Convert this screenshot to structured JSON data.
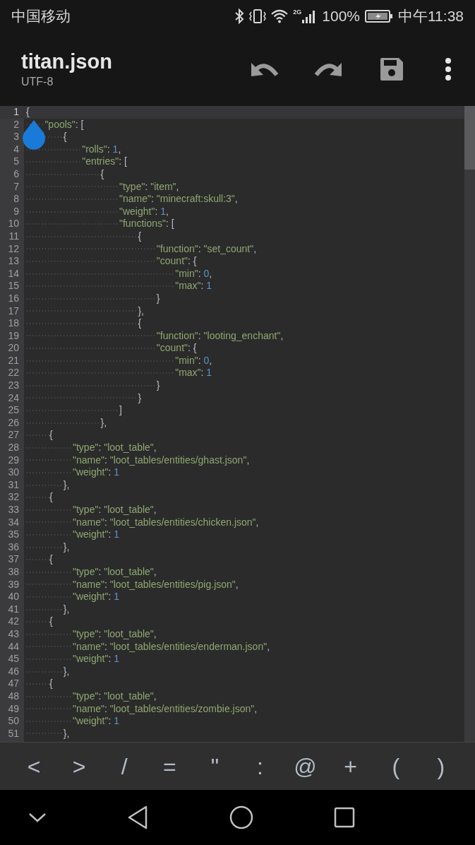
{
  "status_bar": {
    "carrier": "中国移动",
    "network": "2G",
    "battery": "100%",
    "time": "中午11:38"
  },
  "toolbar": {
    "title": "titan.json",
    "encoding": "UTF-8"
  },
  "editor": {
    "lines": [
      {
        "number": "1",
        "text": "{",
        "selected": true
      },
      {
        "number": "2",
        "text": "    \"pools\": [",
        "selected": false
      },
      {
        "number": "3",
        "text": "        {",
        "selected": false
      },
      {
        "number": "4",
        "text": "            \"rolls\": 1,",
        "selected": false
      },
      {
        "number": "5",
        "text": "            \"entries\": [",
        "selected": false
      },
      {
        "number": "6",
        "text": "                {",
        "selected": false
      },
      {
        "number": "7",
        "text": "                    \"type\": \"item\",",
        "selected": false
      },
      {
        "number": "8",
        "text": "                    \"name\": \"minecraft:skull:3\",",
        "selected": false
      },
      {
        "number": "9",
        "text": "                    \"weight\": 1,",
        "selected": false
      },
      {
        "number": "10",
        "text": "                    \"functions\": [",
        "selected": false
      },
      {
        "number": "11",
        "text": "                        {",
        "selected": false
      },
      {
        "number": "12",
        "text": "                            \"function\": \"set_count\",",
        "selected": false
      },
      {
        "number": "13",
        "text": "                            \"count\": {",
        "selected": false
      },
      {
        "number": "14",
        "text": "                                \"min\": 0,",
        "selected": false
      },
      {
        "number": "15",
        "text": "                                \"max\": 1",
        "selected": false
      },
      {
        "number": "16",
        "text": "                            }",
        "selected": false
      },
      {
        "number": "17",
        "text": "                        },",
        "selected": false
      },
      {
        "number": "18",
        "text": "                        {",
        "selected": false
      },
      {
        "number": "19",
        "text": "                            \"function\": \"looting_enchant\",",
        "selected": false
      },
      {
        "number": "20",
        "text": "                            \"count\": {",
        "selected": false
      },
      {
        "number": "21",
        "text": "                                \"min\": 0,",
        "selected": false
      },
      {
        "number": "22",
        "text": "                                \"max\": 1",
        "selected": false
      },
      {
        "number": "23",
        "text": "                            }",
        "selected": false
      },
      {
        "number": "24",
        "text": "                        }",
        "selected": false
      },
      {
        "number": "25",
        "text": "                    ]",
        "selected": false
      },
      {
        "number": "26",
        "text": "                },",
        "selected": false
      },
      {
        "number": "27",
        "text": "     {",
        "selected": false
      },
      {
        "number": "28",
        "text": "          \"type\": \"loot_table\",",
        "selected": false
      },
      {
        "number": "29",
        "text": "          \"name\": \"loot_tables/entities/ghast.json\",",
        "selected": false
      },
      {
        "number": "30",
        "text": "          \"weight\": 1",
        "selected": false
      },
      {
        "number": "31",
        "text": "        },",
        "selected": false
      },
      {
        "number": "32",
        "text": "     {",
        "selected": false
      },
      {
        "number": "33",
        "text": "          \"type\": \"loot_table\",",
        "selected": false
      },
      {
        "number": "34",
        "text": "          \"name\": \"loot_tables/entities/chicken.json\",",
        "selected": false
      },
      {
        "number": "35",
        "text": "          \"weight\": 1",
        "selected": false
      },
      {
        "number": "36",
        "text": "        },",
        "selected": false
      },
      {
        "number": "37",
        "text": "     {",
        "selected": false
      },
      {
        "number": "38",
        "text": "          \"type\": \"loot_table\",",
        "selected": false
      },
      {
        "number": "39",
        "text": "          \"name\": \"loot_tables/entities/pig.json\",",
        "selected": false
      },
      {
        "number": "40",
        "text": "          \"weight\": 1",
        "selected": false
      },
      {
        "number": "41",
        "text": "        },",
        "selected": false
      },
      {
        "number": "42",
        "text": "     {",
        "selected": false
      },
      {
        "number": "43",
        "text": "          \"type\": \"loot_table\",",
        "selected": false
      },
      {
        "number": "44",
        "text": "          \"name\": \"loot_tables/entities/enderman.json\",",
        "selected": false
      },
      {
        "number": "45",
        "text": "          \"weight\": 1",
        "selected": false
      },
      {
        "number": "46",
        "text": "        },",
        "selected": false
      },
      {
        "number": "47",
        "text": "     {",
        "selected": false
      },
      {
        "number": "48",
        "text": "          \"type\": \"loot_table\",",
        "selected": false
      },
      {
        "number": "49",
        "text": "          \"name\": \"loot_tables/entities/zombie.json\",",
        "selected": false
      },
      {
        "number": "50",
        "text": "          \"weight\": 1",
        "selected": false
      },
      {
        "number": "51",
        "text": "        },",
        "selected": false
      }
    ]
  },
  "symbol_keys": [
    "<",
    ">",
    "/",
    "=",
    "\"",
    ":",
    "@",
    "+",
    "(",
    ")"
  ]
}
